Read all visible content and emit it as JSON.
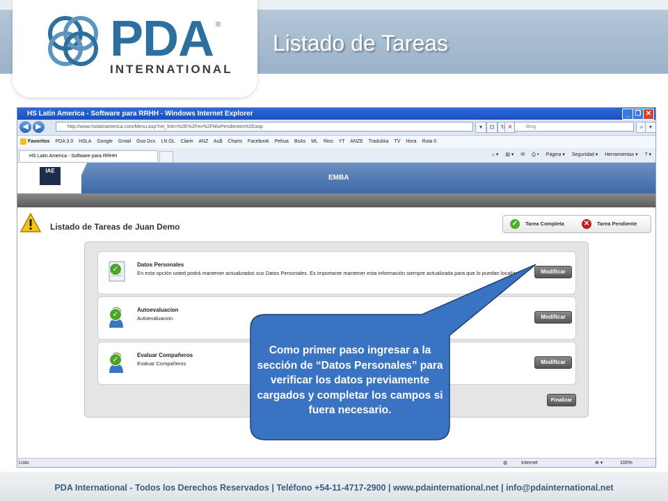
{
  "slide": {
    "logo_text": "PDA",
    "logo_registered": "®",
    "logo_subtitle": "INTERNATIONAL",
    "title": "Listado de Tareas",
    "footer": "PDA International - Todos los Derechos Reservados | Teléfono +54-11-4717-2900 | www.pdainternational.net  | info@pdainternational.net",
    "colors": {
      "brand_blue": "#2d6f9e",
      "header_band": "#a9bdd1",
      "callout_blue": "#3a73c2"
    }
  },
  "browser": {
    "window_title": "HS Latin America - Software para RRHH - Windows Internet Explorer",
    "url": "http://www.hslatinamerica.com/Menu.asp?ret_link=%2E%2Fev%2FMisPendientes%2Easp",
    "search_placeholder": "Bing",
    "favorites_label": "Favoritos",
    "favorites": [
      "PDA 3.0",
      "HSLA",
      "Google",
      "Gmail",
      "Goo Dcs",
      "LN OL",
      "Clarin",
      "ANZ",
      "Au$",
      "Charts",
      "Facebook",
      "Pehua",
      "BsAs",
      "ML",
      "Rios",
      "YT",
      "ANZE",
      "Tradukka",
      "TV",
      "Hora",
      "Ruta 0"
    ],
    "tab_label": "HS Latin America - Software para RRHH",
    "commands": {
      "page": "Página ▾",
      "security": "Seguridad ▾",
      "tools": "Herramientas ▾"
    },
    "status_left": "Listo",
    "status_zone": "Internet",
    "zoom": "100%"
  },
  "app": {
    "logo_text": "IAE",
    "banner_label": "EMBA",
    "list_title": "Listado de Tareas de Juan Demo",
    "legend_complete": "Tarea Completa",
    "legend_pending": "Tarea Pendiente",
    "tasks": [
      {
        "title": "Datos Personales",
        "description": "En esta opción usted podrá mantener actualizados sus Datos Personales. Es importante mantener esta información siempre actualizada para que lo puedan localizar.",
        "button": "Modificar",
        "status": "completa"
      },
      {
        "title": "Autoevaluacion",
        "description": "Autoevaluacion",
        "button": "Modificar",
        "status": "completa"
      },
      {
        "title": "Evaluar Compañeros",
        "description": "Evaluar Compañeros",
        "button": "Modificar",
        "status": "completa"
      }
    ],
    "finalize_button": "Finalizar"
  },
  "callout": {
    "text": "Como primer paso ingresar a la sección de “Datos Personales” para verificar los datos previamente cargados y completar los campos si fuera necesario."
  }
}
